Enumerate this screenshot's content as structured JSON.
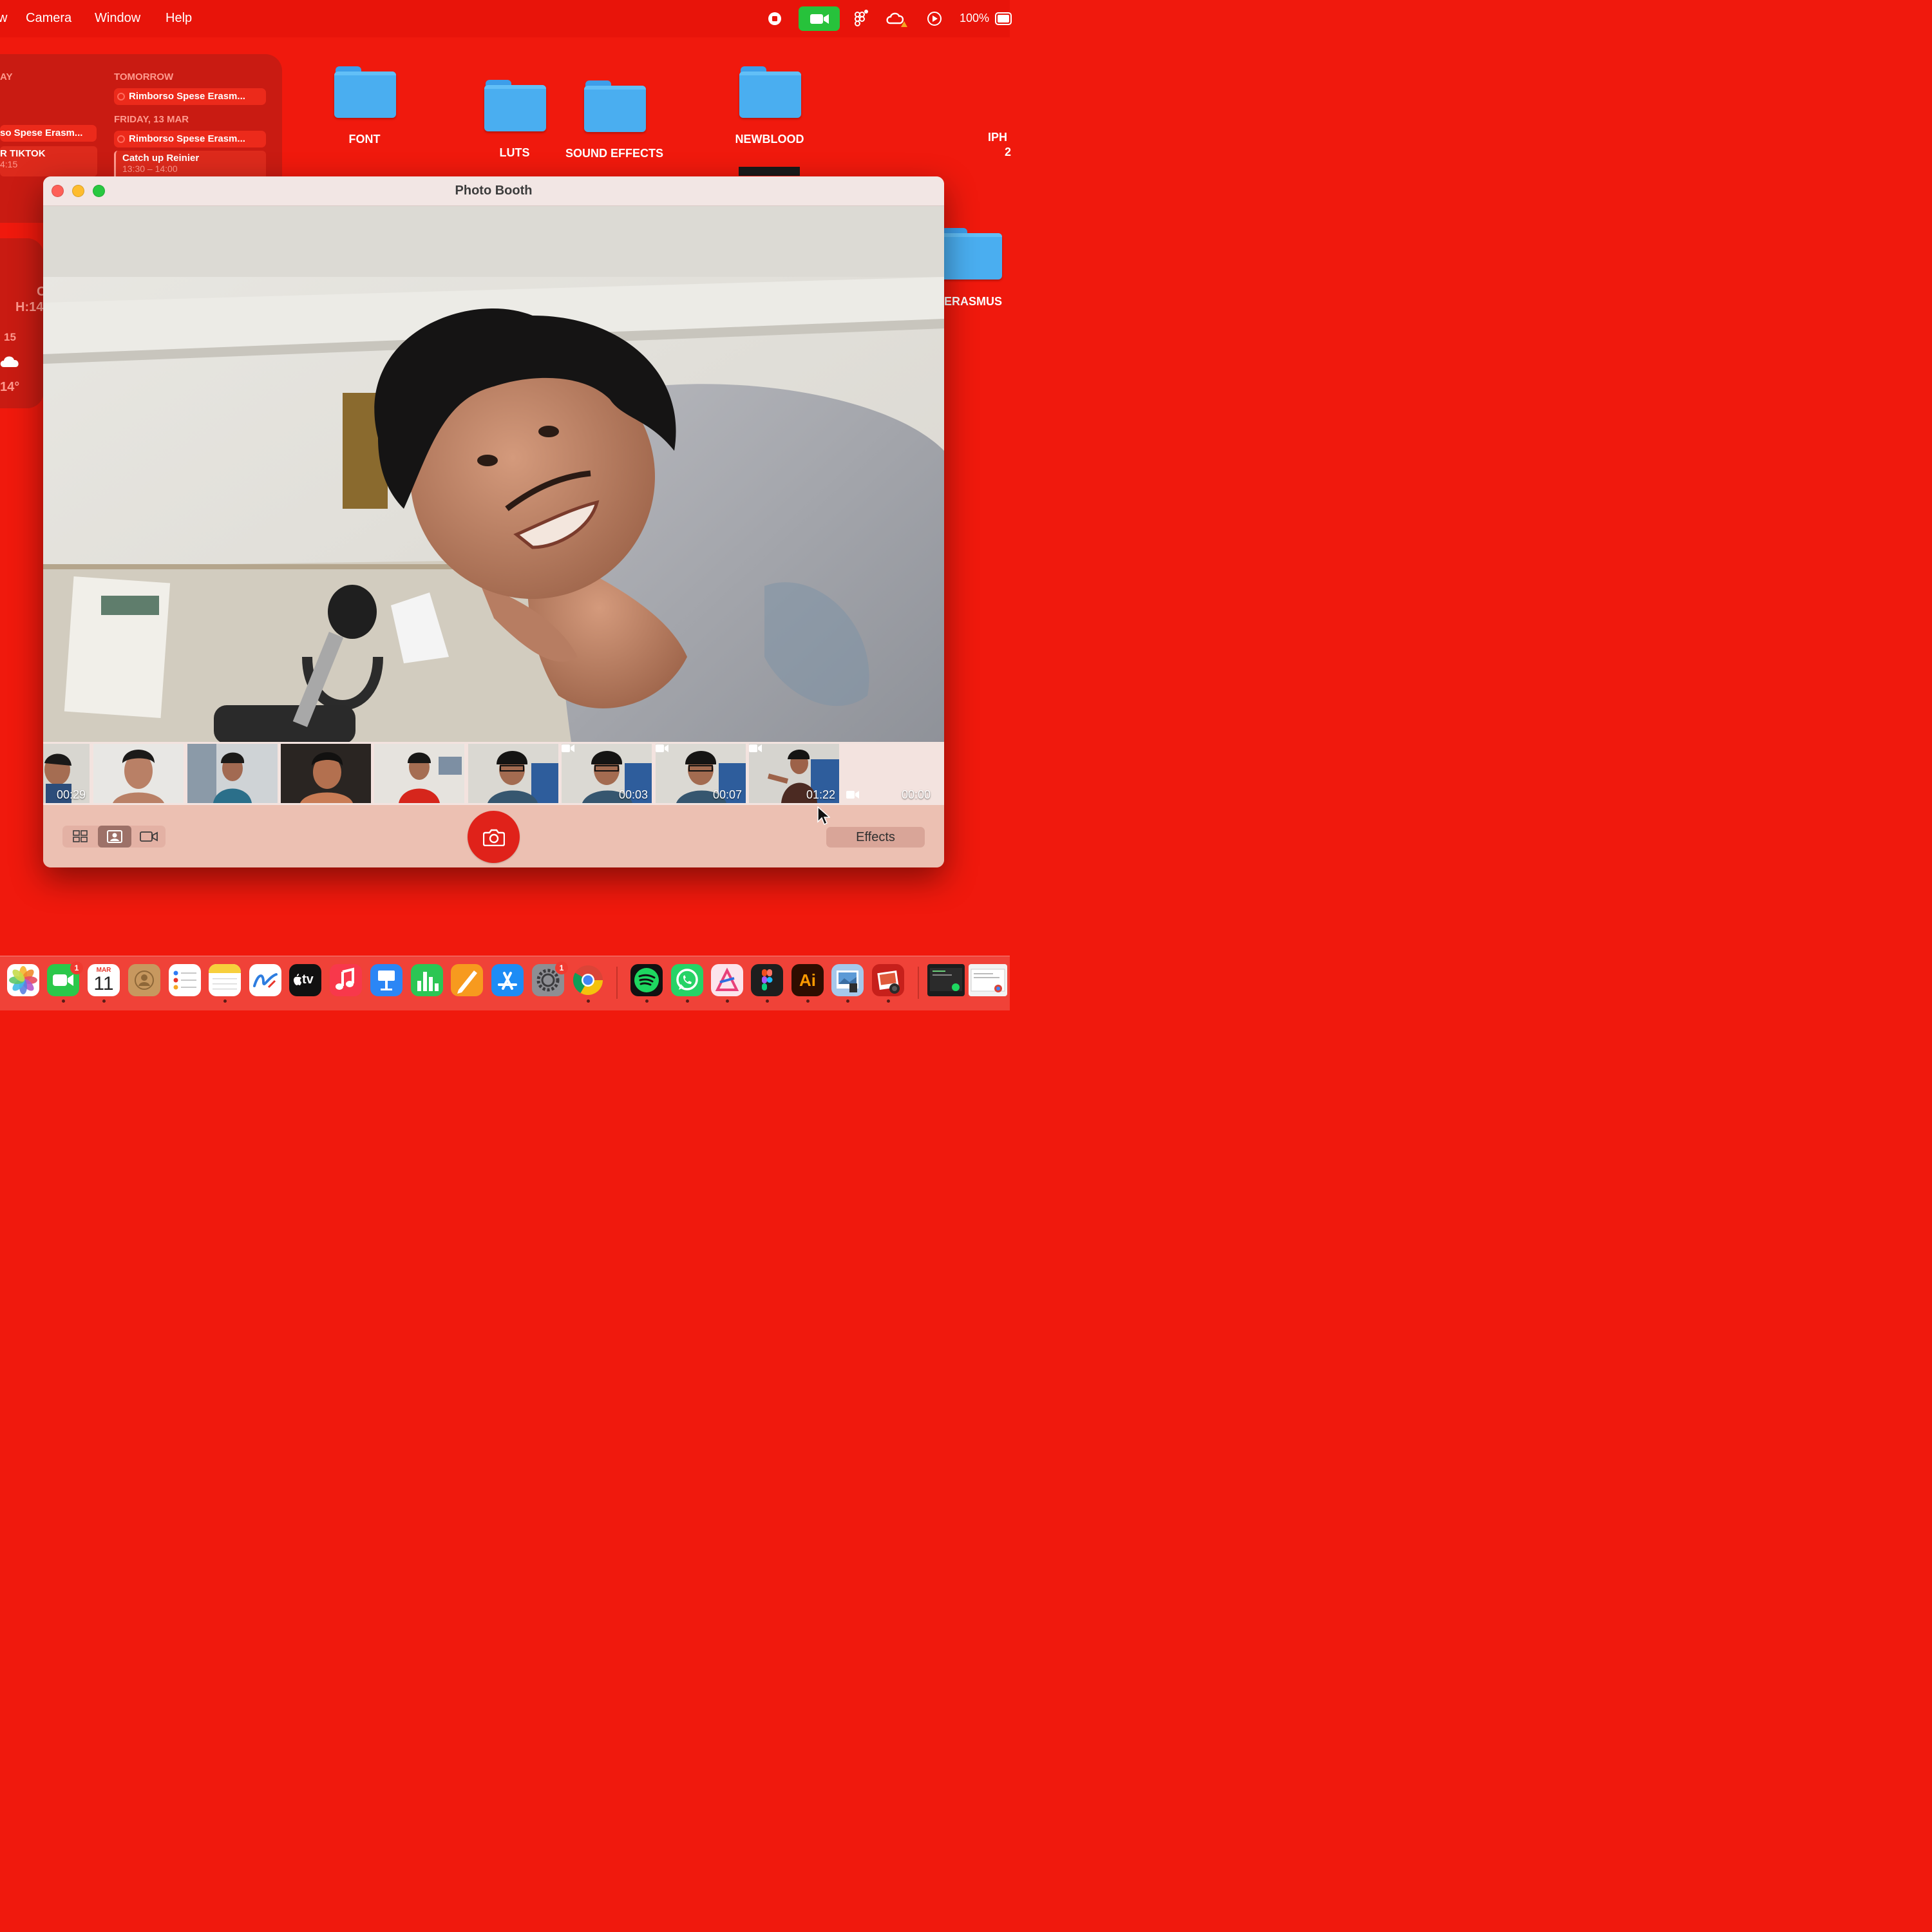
{
  "menubar": {
    "items": [
      "w",
      "Camera",
      "Window",
      "Help"
    ],
    "battery_text": "100%"
  },
  "calendar_widget": {
    "col_today_header": "AY",
    "col_tomorrow_header": "TOMORROW",
    "col_friday_header": "FRIDAY, 13 MAR",
    "tomorrow_event": "Rimborso Spese Erasm...",
    "friday_event": "Rimborso Spese Erasm...",
    "today_event_1": "so Spese Erasm...",
    "today_event_2_title": "R TIKTOK",
    "today_event_2_time": "4:15",
    "friday_event_2_title": "Catch up Reinier",
    "friday_event_2_time": "13:30 – 14:00"
  },
  "weather_widget": {
    "line1": "C",
    "high": "H:14",
    "hour": "15",
    "temp": "14°"
  },
  "desktop": {
    "folders": [
      "FONT",
      "LUTS",
      "SOUND EFFECTS",
      "NEWBLOOD",
      "ERASMUS"
    ],
    "partial_label_1": "IPH",
    "partial_label_2": "2"
  },
  "photo_booth": {
    "title": "Photo Booth",
    "thumbnails": [
      {
        "time": "00:29",
        "video": false
      },
      {
        "time": "",
        "video": false
      },
      {
        "time": "",
        "video": false
      },
      {
        "time": "",
        "video": false
      },
      {
        "time": "",
        "video": false
      },
      {
        "time": "",
        "video": false
      },
      {
        "time": "00:03",
        "video": true
      },
      {
        "time": "00:07",
        "video": true
      },
      {
        "time": "01:22",
        "video": true
      }
    ],
    "recording_time": "00:00",
    "effects_label": "Effects",
    "mode_buttons": [
      "grid-mode",
      "photo-mode",
      "video-mode"
    ]
  },
  "dock": {
    "apps": [
      "Photos",
      "FaceTime",
      "Calendar",
      "Contacts",
      "Reminders",
      "Notes",
      "Freeform",
      "TV",
      "Music",
      "Keynote",
      "Numbers",
      "Pages",
      "App Store",
      "System Settings",
      "Chrome",
      "Spotify",
      "WhatsApp",
      "Affinity",
      "Figma",
      "Illustrator",
      "Preview",
      "Photo Booth"
    ],
    "facetime_badge": "1",
    "settings_badge": "1",
    "calendar_month": "MAR",
    "calendar_day": "11",
    "tv_label": "tv",
    "illustrator_label": "Ai"
  },
  "colors": {
    "desktop": "#f0190d",
    "widget": "#c91b12",
    "folder": "#4aaef0",
    "shutter": "#e0221a",
    "toolbar": "#ecc0b2"
  }
}
